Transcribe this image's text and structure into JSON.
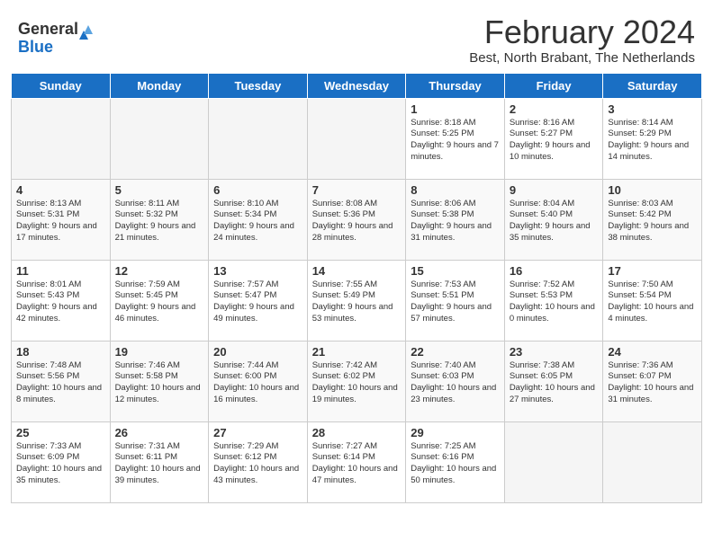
{
  "header": {
    "logo_line1": "General",
    "logo_line2": "Blue",
    "title": "February 2024",
    "subtitle": "Best, North Brabant, The Netherlands"
  },
  "days_of_week": [
    "Sunday",
    "Monday",
    "Tuesday",
    "Wednesday",
    "Thursday",
    "Friday",
    "Saturday"
  ],
  "weeks": [
    [
      {
        "day": "",
        "info": ""
      },
      {
        "day": "",
        "info": ""
      },
      {
        "day": "",
        "info": ""
      },
      {
        "day": "",
        "info": ""
      },
      {
        "day": "1",
        "info": "Sunrise: 8:18 AM\nSunset: 5:25 PM\nDaylight: 9 hours and 7 minutes."
      },
      {
        "day": "2",
        "info": "Sunrise: 8:16 AM\nSunset: 5:27 PM\nDaylight: 9 hours and 10 minutes."
      },
      {
        "day": "3",
        "info": "Sunrise: 8:14 AM\nSunset: 5:29 PM\nDaylight: 9 hours and 14 minutes."
      }
    ],
    [
      {
        "day": "4",
        "info": "Sunrise: 8:13 AM\nSunset: 5:31 PM\nDaylight: 9 hours and 17 minutes."
      },
      {
        "day": "5",
        "info": "Sunrise: 8:11 AM\nSunset: 5:32 PM\nDaylight: 9 hours and 21 minutes."
      },
      {
        "day": "6",
        "info": "Sunrise: 8:10 AM\nSunset: 5:34 PM\nDaylight: 9 hours and 24 minutes."
      },
      {
        "day": "7",
        "info": "Sunrise: 8:08 AM\nSunset: 5:36 PM\nDaylight: 9 hours and 28 minutes."
      },
      {
        "day": "8",
        "info": "Sunrise: 8:06 AM\nSunset: 5:38 PM\nDaylight: 9 hours and 31 minutes."
      },
      {
        "day": "9",
        "info": "Sunrise: 8:04 AM\nSunset: 5:40 PM\nDaylight: 9 hours and 35 minutes."
      },
      {
        "day": "10",
        "info": "Sunrise: 8:03 AM\nSunset: 5:42 PM\nDaylight: 9 hours and 38 minutes."
      }
    ],
    [
      {
        "day": "11",
        "info": "Sunrise: 8:01 AM\nSunset: 5:43 PM\nDaylight: 9 hours and 42 minutes."
      },
      {
        "day": "12",
        "info": "Sunrise: 7:59 AM\nSunset: 5:45 PM\nDaylight: 9 hours and 46 minutes."
      },
      {
        "day": "13",
        "info": "Sunrise: 7:57 AM\nSunset: 5:47 PM\nDaylight: 9 hours and 49 minutes."
      },
      {
        "day": "14",
        "info": "Sunrise: 7:55 AM\nSunset: 5:49 PM\nDaylight: 9 hours and 53 minutes."
      },
      {
        "day": "15",
        "info": "Sunrise: 7:53 AM\nSunset: 5:51 PM\nDaylight: 9 hours and 57 minutes."
      },
      {
        "day": "16",
        "info": "Sunrise: 7:52 AM\nSunset: 5:53 PM\nDaylight: 10 hours and 0 minutes."
      },
      {
        "day": "17",
        "info": "Sunrise: 7:50 AM\nSunset: 5:54 PM\nDaylight: 10 hours and 4 minutes."
      }
    ],
    [
      {
        "day": "18",
        "info": "Sunrise: 7:48 AM\nSunset: 5:56 PM\nDaylight: 10 hours and 8 minutes."
      },
      {
        "day": "19",
        "info": "Sunrise: 7:46 AM\nSunset: 5:58 PM\nDaylight: 10 hours and 12 minutes."
      },
      {
        "day": "20",
        "info": "Sunrise: 7:44 AM\nSunset: 6:00 PM\nDaylight: 10 hours and 16 minutes."
      },
      {
        "day": "21",
        "info": "Sunrise: 7:42 AM\nSunset: 6:02 PM\nDaylight: 10 hours and 19 minutes."
      },
      {
        "day": "22",
        "info": "Sunrise: 7:40 AM\nSunset: 6:03 PM\nDaylight: 10 hours and 23 minutes."
      },
      {
        "day": "23",
        "info": "Sunrise: 7:38 AM\nSunset: 6:05 PM\nDaylight: 10 hours and 27 minutes."
      },
      {
        "day": "24",
        "info": "Sunrise: 7:36 AM\nSunset: 6:07 PM\nDaylight: 10 hours and 31 minutes."
      }
    ],
    [
      {
        "day": "25",
        "info": "Sunrise: 7:33 AM\nSunset: 6:09 PM\nDaylight: 10 hours and 35 minutes."
      },
      {
        "day": "26",
        "info": "Sunrise: 7:31 AM\nSunset: 6:11 PM\nDaylight: 10 hours and 39 minutes."
      },
      {
        "day": "27",
        "info": "Sunrise: 7:29 AM\nSunset: 6:12 PM\nDaylight: 10 hours and 43 minutes."
      },
      {
        "day": "28",
        "info": "Sunrise: 7:27 AM\nSunset: 6:14 PM\nDaylight: 10 hours and 47 minutes."
      },
      {
        "day": "29",
        "info": "Sunrise: 7:25 AM\nSunset: 6:16 PM\nDaylight: 10 hours and 50 minutes."
      },
      {
        "day": "",
        "info": ""
      },
      {
        "day": "",
        "info": ""
      }
    ]
  ]
}
